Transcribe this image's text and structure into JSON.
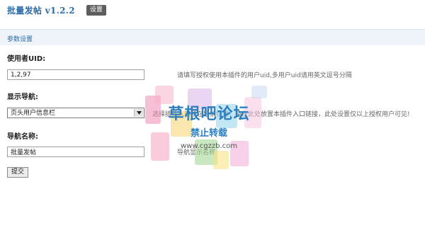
{
  "header": {
    "app_title": "批量发帖 v1.2.2",
    "settings_button": "设置"
  },
  "section": {
    "title": "参数设置"
  },
  "form": {
    "uid": {
      "label": "使用者UID:",
      "value": "1,2,97",
      "hint": "请填写授权使用本插件的用户uid,多用户uid请用英文逗号分隔"
    },
    "nav_display": {
      "label": "显示导航:",
      "selected": "页头用户信息栏",
      "hint": "选择插件入口所在导航位置，将在此处放置本插件入口链接，此处设置仅以上授权用户可见!"
    },
    "nav_name": {
      "label": "导航名称:",
      "value": "批量发帖",
      "hint": "导航显示名称"
    },
    "submit_label": "提交"
  },
  "watermark": {
    "title": "草根吧论坛",
    "subtitle": "禁止转载",
    "url": "www.cgzzb.com"
  },
  "colors": {
    "accent": "#2b6aa8",
    "section_bg": "#eef4f9",
    "settings_btn_bg": "#5d5d5d"
  }
}
